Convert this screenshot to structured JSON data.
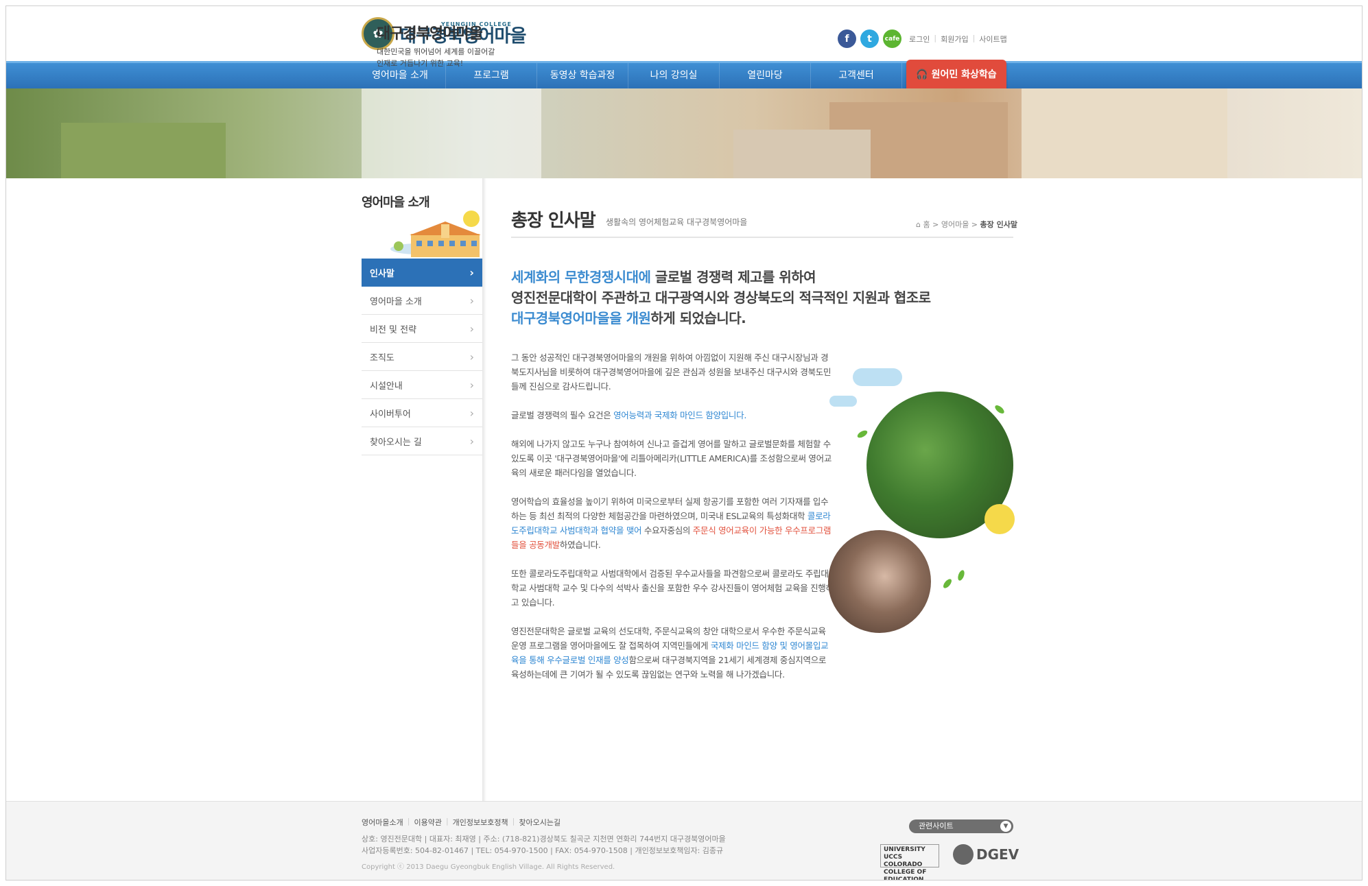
{
  "header": {
    "logo_small": "YEUNGJIN COLLEGE",
    "logo_main": "대구경북영어마을",
    "social": [
      {
        "name": "facebook-icon",
        "label": "f"
      },
      {
        "name": "twitter-icon",
        "label": "t"
      },
      {
        "name": "cafe-icon",
        "label": "cafe"
      }
    ],
    "links": [
      "로그인",
      "회원가입",
      "사이트맵"
    ]
  },
  "nav": {
    "items": [
      "영어마을 소개",
      "프로그램",
      "동영상 학습과정",
      "나의 강의실",
      "열린마당",
      "고객센터"
    ],
    "special": "원어민 화상학습"
  },
  "banner": {
    "title": "대구경북영어마을",
    "subtitle_line1": "대한민국을 뛰어넘어 세계를 이끌어갈",
    "subtitle_line2": "인재로 거듭나기 위한 교육!"
  },
  "sidebar": {
    "title": "영어마을 소개",
    "items": [
      "인사말",
      "영어마을 소개",
      "비전 및 전략",
      "조직도",
      "시설안내",
      "사이버투어",
      "찾아오시는 길"
    ]
  },
  "content": {
    "title": "총장 인사말",
    "subtitle": "생활속의 영어체험교육 대구경북영어마을",
    "breadcrumb": {
      "home": "홈",
      "section": "영어마을",
      "current": "총장 인사말"
    },
    "lead": {
      "l1_blue": "세계화의 무한경쟁시대에",
      "l1_rest": " 글로벌 경쟁력 제고를 위하여",
      "l2": "영진전문대학이 주관하고 대구광역시와 경상북도의 적극적인 지원과 협조로",
      "l3_blue": "대구경북영어마을을 개원",
      "l3_rest": "하게 되었습니다."
    },
    "p1": "그 동안 성공적인 대구경북영어마을의 개원을 위하여 아낌없이 지원해 주신 대구시장님과 경북도지사님을 비롯하여 대구경북영어마을에 깊은 관심과 성원을 보내주신 대구시와 경북도민들께 진심으로 감사드립니다.",
    "p2_a": "글로벌 경쟁력의 필수 요건은 ",
    "p2_blue": "영어능력과 국제화 마인드 함양입니다.",
    "p3": "해외에 나가지 않고도 누구나 참여하여 신나고 즐겁게 영어를 말하고 글로벌문화를 체험할 수 있도록 이곳 '대구경북영어마을'에 리틀아메리카(LITTLE AMERICA)를 조성함으로써 영어교육의 새로운 패러다임을 열었습니다.",
    "p4_a": "영어학습의 효율성을 높이기 위하여 미국으로부터 실제 항공기를 포함한 여러 기자재를 입수하는 등 최선 최적의 다양한 체험공간을 마련하였으며, 미국내 ESL교육의 특성화대학 ",
    "p4_blue": "콜로라도주립대학교 사범대학과 협약을 맺어",
    "p4_b": " 수요자중심의 ",
    "p4_red": "주문식 영어교육이 가능한 우수프로그램들을 공동개발",
    "p4_c": "하였습니다.",
    "p5": "또한 콜로라도주립대학교 사범대학에서 검증된 우수교사들을 파견함으로써 콜로라도 주립대학교 사범대학 교수 및 다수의 석박사 출신을 포함한 우수 강사진들이 영어체험 교육을 진행하고 있습니다.",
    "p6_a": "영진전문대학은 글로벌 교육의 선도대학, 주문식교육의 창안 대학으로서 우수한 주문식교육 운영 프로그램을 영어마을에도 잘 접목하여 지역민들에게 ",
    "p6_blue": "국제화 마인드 함양 및 영어몰입교육을 통해 우수글로벌 인재를 양성",
    "p6_b": "함으로써 대구경북지역을 21세기 세계경제 중심지역으로 육성하는데에 큰 기여가 될 수 있도록 끊임없는 연구와 노력을 해 나가겠습니다."
  },
  "footer": {
    "links": [
      "영어마을소개",
      "이용약관",
      "개인정보보호정책",
      "찾아오시는길"
    ],
    "info1": "상호: 영진전문대학 | 대표자: 최재영 | 주소: (718-821)경상북도 칠곡군 지천면 연화리 744번지 대구경북영어마을",
    "info2": "사업자등록번호: 504-82-01467 | TEL: 054-970-1500 | FAX: 054-970-1508 | 개인정보보호책임자: 김종규",
    "copyright": "Copyright ⓒ 2013 Daegu Gyeongbuk English Village. All Rights Reserved.",
    "related": "관련사이트",
    "logo1_line1": "UNIVERSITY",
    "logo1_line2": "UCCS COLORADO",
    "logo1_line3": "COLLEGE OF EDUCATION",
    "logo2": "DGEV"
  },
  "colors": {
    "nav_blue": "#2c71b7",
    "accent_blue": "#3b8bd0",
    "accent_red": "#e2533f"
  }
}
